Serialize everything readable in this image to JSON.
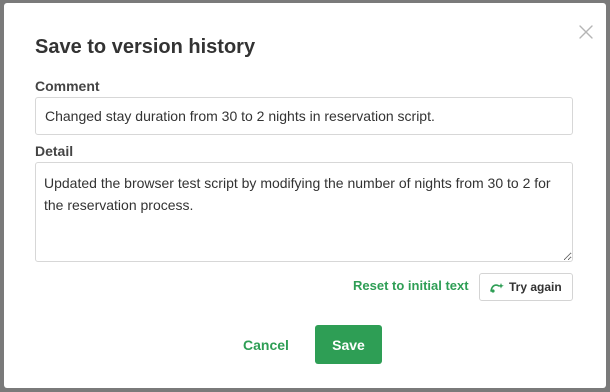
{
  "dialog": {
    "title": "Save to version history",
    "close_icon": "close-icon"
  },
  "comment": {
    "label": "Comment",
    "value": "Changed stay duration from 30 to 2 nights in reservation script."
  },
  "detail": {
    "label": "Detail",
    "value": "Updated the browser test script by modifying the number of nights from 30 to 2 for the reservation process."
  },
  "actions": {
    "reset_label": "Reset to initial text",
    "try_again_label": "Try again",
    "try_again_icon": "ai-sparkle-icon",
    "cancel_label": "Cancel",
    "save_label": "Save"
  },
  "colors": {
    "accent": "#2e9e55",
    "overlay": "#7a7a7a",
    "text": "#333333"
  }
}
